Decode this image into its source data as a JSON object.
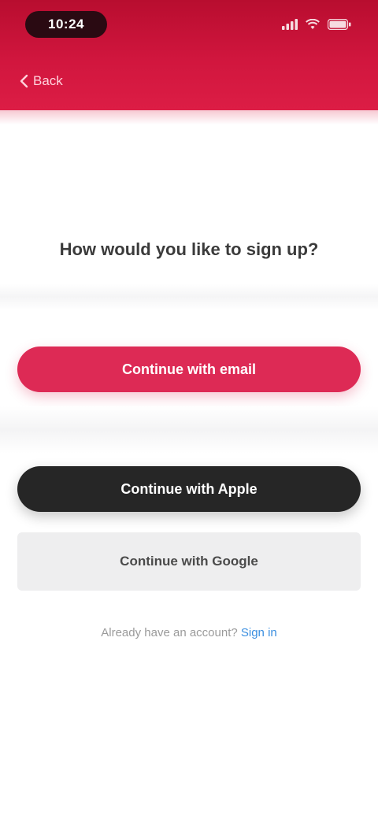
{
  "status_bar": {
    "time": "10:24",
    "icons": [
      "signal-icon",
      "wifi-icon",
      "battery-icon"
    ]
  },
  "header": {
    "back_label": "Back"
  },
  "main": {
    "prompt": "How would you like to sign up?",
    "primary_button": "Continue with email",
    "dark_button": "Continue with Apple",
    "secondary_button": "Continue with Google",
    "signin_prompt": "Already have an account?",
    "signin_link": "Sign in"
  },
  "colors": {
    "brand": "#d1163e",
    "primary": "#dd2a55",
    "dark": "#262626",
    "link": "#3b8fe0"
  }
}
